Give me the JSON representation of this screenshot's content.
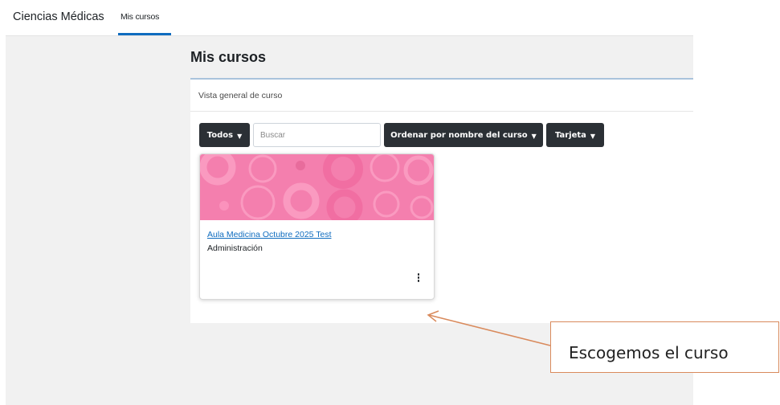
{
  "nav": {
    "site_name": "Ciencias Médicas",
    "active_item": "Mis cursos"
  },
  "page": {
    "title": "Mis cursos"
  },
  "overview": {
    "title": "Vista general de curso",
    "filter_label": "Todos",
    "search_placeholder": "Buscar",
    "sort_label": "Ordenar por nombre del curso",
    "view_label": "Tarjeta"
  },
  "course": {
    "name": "Aula Medicina Octubre 2025 Test",
    "category": "Administración",
    "image_color": "#f47fae"
  },
  "annotation": {
    "text": "Escogemos el curso",
    "color": "#d98a5c"
  },
  "colors": {
    "accent": "#0f6cbf",
    "dark_button": "#2b3035"
  }
}
